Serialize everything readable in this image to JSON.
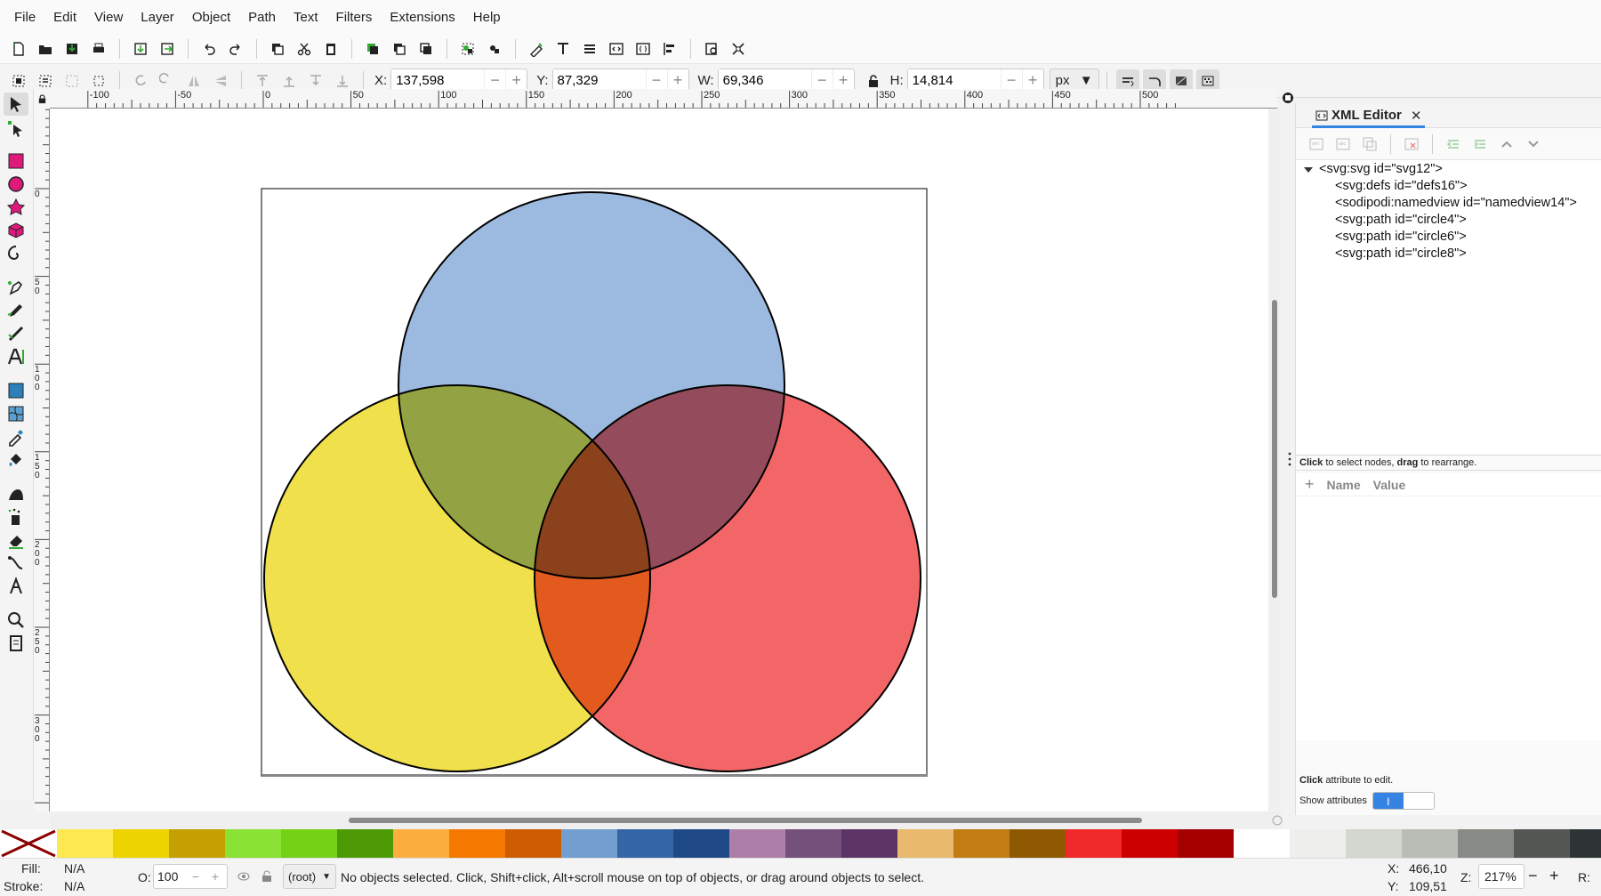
{
  "menu": [
    "File",
    "Edit",
    "View",
    "Layer",
    "Object",
    "Path",
    "Text",
    "Filters",
    "Extensions",
    "Help"
  ],
  "controls": {
    "x": {
      "label": "X:",
      "value": "137,598"
    },
    "y": {
      "label": "Y:",
      "value": "87,329"
    },
    "w": {
      "label": "W:",
      "value": "69,346"
    },
    "h": {
      "label": "H:",
      "value": "14,814"
    },
    "unit": "px"
  },
  "ruler": {
    "h_labels": [
      "-100",
      "-50",
      "0",
      "50",
      "100",
      "150",
      "200",
      "250",
      "300",
      "350",
      "400",
      "450",
      "500"
    ],
    "v_labels": [
      "0",
      "5\n0",
      "1\n0\n0",
      "1\n5\n0",
      "2\n0\n0",
      "2\n5\n0",
      "3\n0\n0"
    ]
  },
  "dock": {
    "tab_title": "XML Editor",
    "nodes": [
      "<svg:svg id=\"svg12\">",
      "<svg:defs id=\"defs16\">",
      "<sodipodi:namedview id=\"namedview14\">",
      "<svg:path id=\"circle4\">",
      "<svg:path id=\"circle6\">",
      "<svg:path id=\"circle8\">"
    ],
    "hint_nodes_bold1": "Click",
    "hint_nodes_mid": " to select nodes, ",
    "hint_nodes_bold2": "drag",
    "hint_nodes_end": " to rearrange.",
    "attr_col_name": "Name",
    "attr_col_value": "Value",
    "hint_attr_bold": "Click",
    "hint_attr_end": " attribute to edit.",
    "show_attributes": "Show attributes"
  },
  "palette": [
    "#fce94f",
    "#edd400",
    "#c4a000",
    "#8ae234",
    "#73d216",
    "#4e9a06",
    "#fcaf3e",
    "#f57900",
    "#ce5c00",
    "#729fcf",
    "#3465a4",
    "#204a87",
    "#ad7fa8",
    "#75507b",
    "#5c3566",
    "#e9b96e",
    "#c17d11",
    "#8f5902",
    "#ef2929",
    "#cc0000",
    "#a40000",
    "#ffffff",
    "#eeeeec",
    "#d3d7cf",
    "#babdb6",
    "#888a85",
    "#555753",
    "#2e3436"
  ],
  "status": {
    "fill_label": "Fill:",
    "fill_value": "N/A",
    "stroke_label": "Stroke:",
    "stroke_value": "N/A",
    "opacity_label": "O:",
    "opacity_value": "100",
    "layer": "(root)",
    "message": "No objects selected. Click, Shift+click, Alt+scroll mouse on top of objects, or drag around objects to select.",
    "cursor_x_label": "X:",
    "cursor_x": "466,10",
    "cursor_y_label": "Y:",
    "cursor_y": "109,51",
    "zoom_label": "Z:",
    "zoom": "217%",
    "rotate_label": "R:"
  },
  "colors": {
    "circle_top": "#9cbadf",
    "circle_left": "#f0e04c",
    "circle_right": "#f26668"
  }
}
